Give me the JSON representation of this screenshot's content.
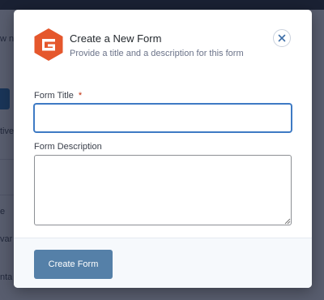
{
  "background": {
    "fragments": [
      "w n",
      "tive",
      "e",
      "var",
      "nta"
    ]
  },
  "modal": {
    "title": "Create a New Form",
    "subtitle": "Provide a title and a description for this form",
    "logo_icon": "gravity-forms-logo-icon",
    "close_icon": "close-icon",
    "accent_color": "#e5572c",
    "fields": {
      "title_label": "Form Title",
      "title_required_marker": "*",
      "title_value": "",
      "description_label": "Form Description",
      "description_value": ""
    },
    "submit_label": "Create Form"
  }
}
